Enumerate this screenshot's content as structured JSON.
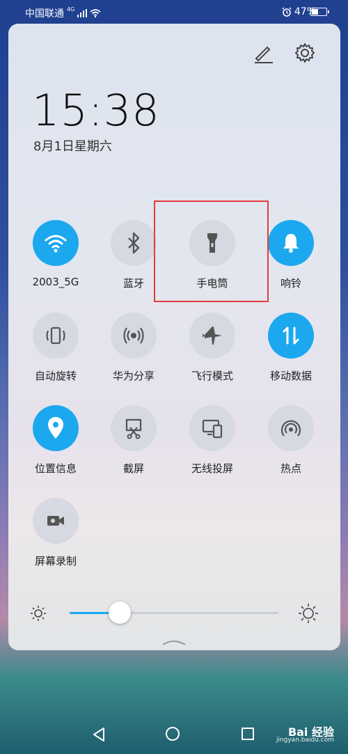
{
  "status_bar": {
    "carrier": "中国联通",
    "network": "4G",
    "battery": "47%",
    "battery_level": 0.47
  },
  "panel": {
    "time": "15:38",
    "date": "8月1日星期六",
    "tiles": [
      {
        "label": "2003_5G",
        "icon": "wifi-icon",
        "on": true
      },
      {
        "label": "蓝牙",
        "icon": "bluetooth-icon",
        "on": false
      },
      {
        "label": "手电筒",
        "icon": "flashlight-icon",
        "on": false
      },
      {
        "label": "响铃",
        "icon": "bell-icon",
        "on": true
      },
      {
        "label": "自动旋转",
        "icon": "auto-rotate-icon",
        "on": false
      },
      {
        "label": "华为分享",
        "icon": "huawei-share-icon",
        "on": false
      },
      {
        "label": "飞行模式",
        "icon": "airplane-icon",
        "on": false
      },
      {
        "label": "移动数据",
        "icon": "mobile-data-icon",
        "on": true
      },
      {
        "label": "位置信息",
        "icon": "location-icon",
        "on": true
      },
      {
        "label": "截屏",
        "icon": "screenshot-icon",
        "on": false
      },
      {
        "label": "无线投屏",
        "icon": "wireless-projection-icon",
        "on": false
      },
      {
        "label": "热点",
        "icon": "hotspot-icon",
        "on": false
      },
      {
        "label": "屏幕录制",
        "icon": "screen-record-icon",
        "on": false
      }
    ],
    "brightness": 0.24
  },
  "watermark": {
    "text": "Bai 经验",
    "url": "jingyan.baidu.com"
  },
  "colors": {
    "accent": "#1ba8ef",
    "tile_off": "#d6d9e2",
    "highlight": "#e33b3b"
  }
}
